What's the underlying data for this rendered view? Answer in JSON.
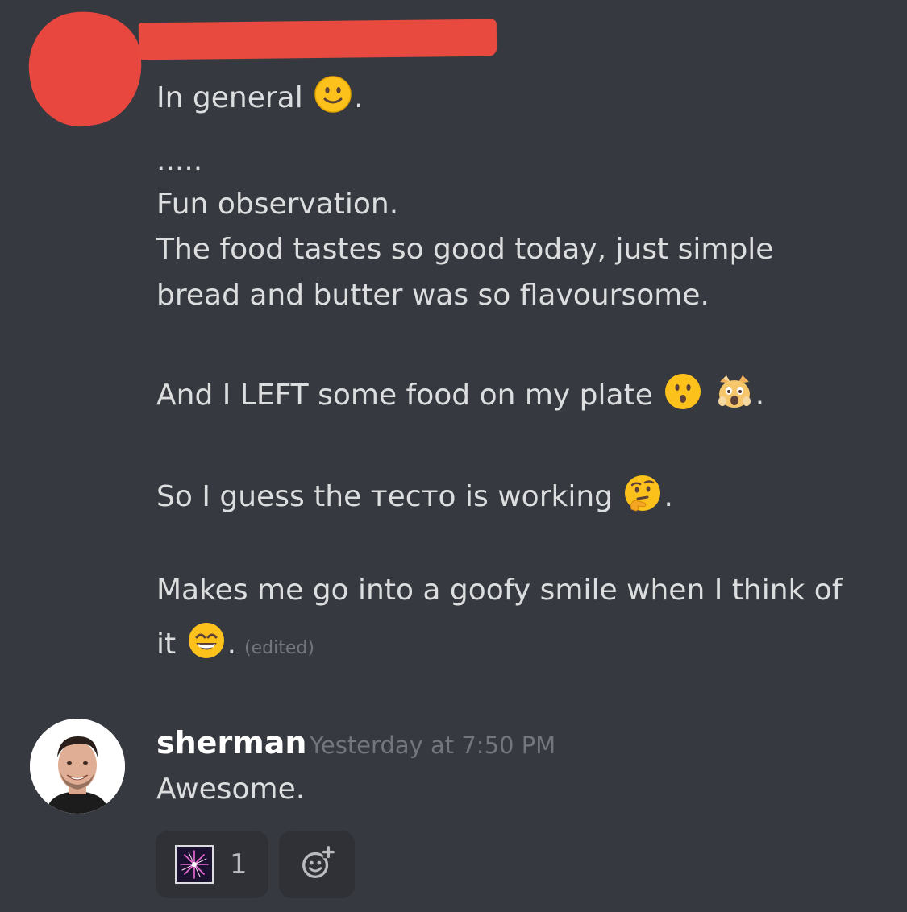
{
  "message": {
    "lines": {
      "l1": "In general",
      "l1_end": ".",
      "l2": ".....",
      "l3": "Fun observation.",
      "l4": "The food tastes so good today, just simple",
      "l5": "bread and butter was so flavoursome.",
      "l6": "And I LEFT some food on my plate",
      "l6_end": ".",
      "l7": "So I guess the тесто is working",
      "l7_end": ".",
      "l8": "Makes me go into a goofy smile when I think of",
      "l9": "it",
      "l9_end": "."
    },
    "edited_label": "(edited)",
    "emoji": [
      "slightly-smiling-face",
      "hushed-face",
      "weary-cat-face",
      "thinking-face",
      "grinning-face-with-smiling-eyes"
    ]
  },
  "reply": {
    "username": "sherman",
    "timestamp": "Yesterday at 7:50 PM",
    "text": "Awesome.",
    "reactions": [
      {
        "emoji": "fireworks",
        "count": "1"
      }
    ],
    "add_reaction_icon": "add-reaction-icon"
  },
  "colors": {
    "background": "#36393f",
    "text": "#dcddde",
    "muted": "#72767d",
    "reaction_bg": "#2f3136",
    "redaction": "#e8473f"
  }
}
